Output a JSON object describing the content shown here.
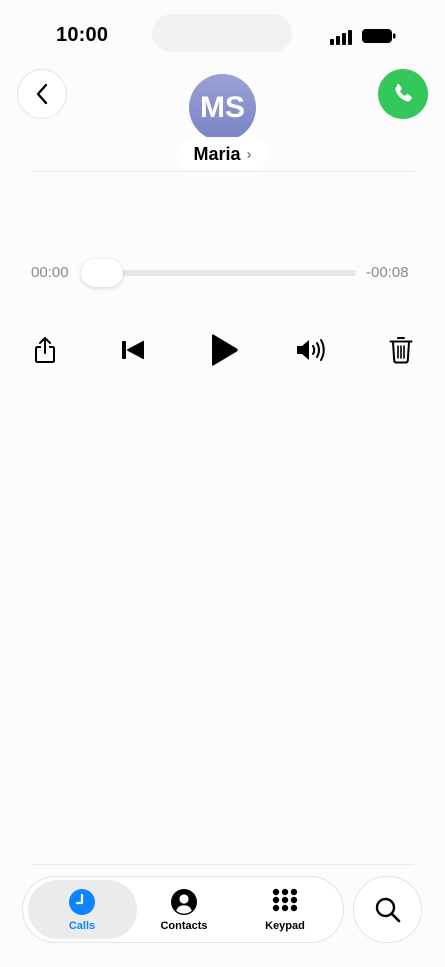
{
  "status_bar": {
    "time": "10:00"
  },
  "header": {
    "avatar_initials": "MS",
    "contact_name": "Maria",
    "chevron": "›"
  },
  "player": {
    "elapsed": "00:00",
    "remaining": "-00:08",
    "progress": 0.0
  },
  "controls": [
    {
      "name": "share",
      "icon": "share-icon"
    },
    {
      "name": "skip-back",
      "icon": "skip-back-icon"
    },
    {
      "name": "play",
      "icon": "play-icon"
    },
    {
      "name": "speaker",
      "icon": "speaker-icon"
    },
    {
      "name": "delete",
      "icon": "trash-icon"
    }
  ],
  "tabbar": {
    "tabs": [
      {
        "label": "Calls",
        "icon": "clock-icon",
        "active": true
      },
      {
        "label": "Contacts",
        "icon": "person-icon",
        "active": false
      },
      {
        "label": "Keypad",
        "icon": "keypad-icon",
        "active": false
      }
    ],
    "search_icon": "search-icon"
  },
  "colors": {
    "accent": "#0a84ff",
    "call_green": "#34c759",
    "avatar": "#8a91cd"
  }
}
